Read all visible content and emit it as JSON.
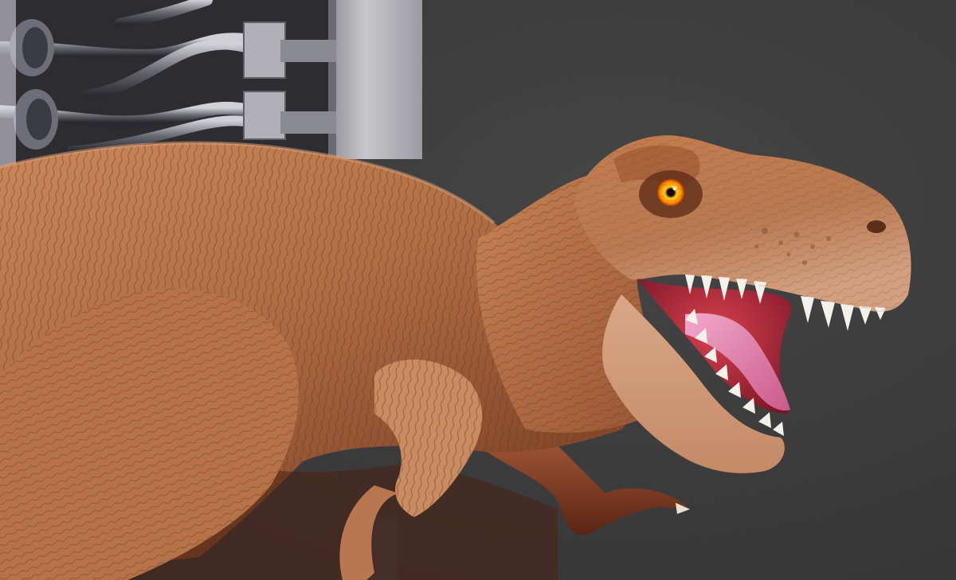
{
  "scene": {
    "subject": "tyrannosaurus-rex-render",
    "colors": {
      "background": "#3a3a3a",
      "background_light": "#454545",
      "skin_base": "#b06e45",
      "skin_light": "#d99b70",
      "skin_shadow": "#5a2e17",
      "belly": "#d8a48a",
      "mouth": "#b02a3a",
      "tongue": "#e58ab8",
      "teeth": "#f4f0ea",
      "eye_iris": "#ff8800",
      "eye_glow": "#ffd21a",
      "machine_metal": "#9a9aa2",
      "machine_dark": "#2a2a30",
      "pillar": "#bdbdc2"
    }
  }
}
